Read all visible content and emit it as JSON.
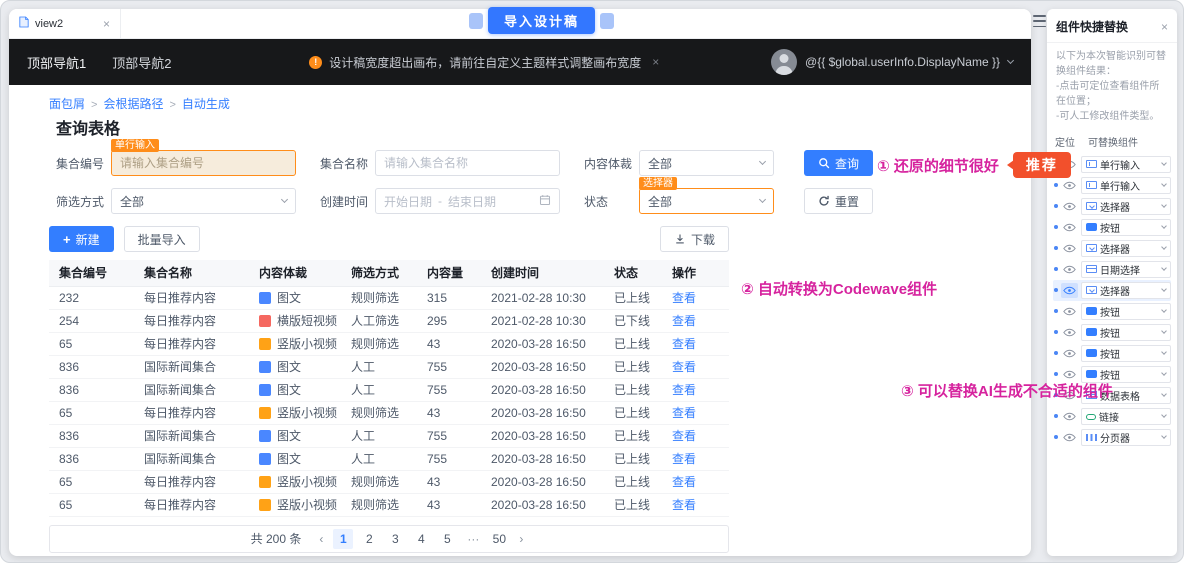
{
  "tab_bar": {
    "tab_title": "view2",
    "close": "×"
  },
  "import_badge": {
    "label": "导入设计稿"
  },
  "navbar": {
    "nav_item1": "顶部导航1",
    "nav_item2": "顶部导航2",
    "warning_text": "设计稿宽度超出画布，请前往自定义主题样式调整画布宽度",
    "warning_close": "×",
    "user_display": "@{{ $global.userInfo.DisplayName }}"
  },
  "breadcrumb": {
    "items": [
      "面包屑",
      "会根据路径",
      "自动生成"
    ],
    "separator": ">"
  },
  "query_form": {
    "title": "查询表格",
    "fields": {
      "collection_id": {
        "label": "集合编号",
        "placeholder": "请输入集合编号",
        "tag": "单行输入"
      },
      "collection_name": {
        "label": "集合名称",
        "placeholder": "请输入集合名称"
      },
      "genre": {
        "label": "内容体裁",
        "value": "全部"
      },
      "filter_method": {
        "label": "筛选方式",
        "value": "全部"
      },
      "create_time": {
        "label": "创建时间",
        "start_placeholder": "开始日期",
        "separator": "-",
        "end_placeholder": "结束日期"
      },
      "status": {
        "label": "状态",
        "value": "全部",
        "tag": "选择器"
      }
    },
    "search_button": "查询",
    "reset_button": "重置"
  },
  "toolbar": {
    "new_button": "新建",
    "batch_import_button": "批量导入",
    "download_button": "下载"
  },
  "table": {
    "columns": [
      "集合编号",
      "集合名称",
      "内容体裁",
      "筛选方式",
      "内容量",
      "创建时间",
      "状态",
      "操作"
    ],
    "action_label": "查看",
    "rows": [
      {
        "id": "232",
        "name": "每日推荐内容",
        "genre": "图文",
        "genre_color": "#4a87ff",
        "filter": "规则筛选",
        "amount": "315",
        "created": "2021-02-28 10:30",
        "status": "已上线"
      },
      {
        "id": "254",
        "name": "每日推荐内容",
        "genre": "横版短视频",
        "genre_color": "#f56860",
        "filter": "人工筛选",
        "amount": "295",
        "created": "2021-02-28 10:30",
        "status": "已下线"
      },
      {
        "id": "65",
        "name": "每日推荐内容",
        "genre": "竖版小视频",
        "genre_color": "#ffa216",
        "filter": "规则筛选",
        "amount": "43",
        "created": "2020-03-28 16:50",
        "status": "已上线"
      },
      {
        "id": "836",
        "name": "国际新闻集合",
        "genre": "图文",
        "genre_color": "#4a87ff",
        "filter": "人工",
        "amount": "755",
        "created": "2020-03-28 16:50",
        "status": "已上线"
      },
      {
        "id": "836",
        "name": "国际新闻集合",
        "genre": "图文",
        "genre_color": "#4a87ff",
        "filter": "人工",
        "amount": "755",
        "created": "2020-03-28 16:50",
        "status": "已上线"
      },
      {
        "id": "65",
        "name": "每日推荐内容",
        "genre": "竖版小视频",
        "genre_color": "#ffa216",
        "filter": "规则筛选",
        "amount": "43",
        "created": "2020-03-28 16:50",
        "status": "已上线"
      },
      {
        "id": "836",
        "name": "国际新闻集合",
        "genre": "图文",
        "genre_color": "#4a87ff",
        "filter": "人工",
        "amount": "755",
        "created": "2020-03-28 16:50",
        "status": "已上线"
      },
      {
        "id": "836",
        "name": "国际新闻集合",
        "genre": "图文",
        "genre_color": "#4a87ff",
        "filter": "人工",
        "amount": "755",
        "created": "2020-03-28 16:50",
        "status": "已上线"
      },
      {
        "id": "65",
        "name": "每日推荐内容",
        "genre": "竖版小视频",
        "genre_color": "#ffa216",
        "filter": "规则筛选",
        "amount": "43",
        "created": "2020-03-28 16:50",
        "status": "已上线"
      },
      {
        "id": "65",
        "name": "每日推荐内容",
        "genre": "竖版小视频",
        "genre_color": "#ffa216",
        "filter": "规则筛选",
        "amount": "43",
        "created": "2020-03-28 16:50",
        "status": "已上线"
      }
    ]
  },
  "pagination": {
    "total": "共 200 条",
    "prev": "‹",
    "next": "›",
    "pages": [
      "1",
      "2",
      "3",
      "4",
      "5",
      "···",
      "50"
    ],
    "active_page": "1"
  },
  "annotations": {
    "note1": "① 还原的细节很好",
    "badge1": "推荐",
    "note2": "② 自动转换为Codewave组件",
    "note3": "③ 可以替换AI生成不合适的组件"
  },
  "side_panel": {
    "title": "组件快捷替换",
    "close": "×",
    "description": [
      "以下为本次智能识别可替换组件结果：",
      "-点击可定位查看组件所在位置；",
      "-可人工修改组件类型。"
    ],
    "header_locate": "定位",
    "header_component": "可替换组件",
    "items": [
      {
        "label": "单行输入",
        "icon": "input-icon",
        "active": false
      },
      {
        "label": "单行输入",
        "icon": "input-icon",
        "active": false
      },
      {
        "label": "选择器",
        "icon": "select-icon",
        "active": false
      },
      {
        "label": "按钮",
        "icon": "button-icon",
        "active": false
      },
      {
        "label": "选择器",
        "icon": "select-icon",
        "active": false
      },
      {
        "label": "日期选择",
        "icon": "date-icon",
        "active": false
      },
      {
        "label": "选择器",
        "icon": "select-icon",
        "active": true
      },
      {
        "label": "按钮",
        "icon": "button-icon",
        "active": false
      },
      {
        "label": "按钮",
        "icon": "button-icon",
        "active": false
      },
      {
        "label": "按钮",
        "icon": "button-icon",
        "active": false
      },
      {
        "label": "按钮",
        "icon": "button-icon",
        "active": false
      },
      {
        "label": "数据表格",
        "icon": "table-icon",
        "active": false
      },
      {
        "label": "链接",
        "icon": "link-icon",
        "active": false
      },
      {
        "label": "分页器",
        "icon": "pagination-icon",
        "active": false
      }
    ]
  },
  "colors": {
    "accent_blue": "#337eff",
    "highlight_orange": "#ff8d1a",
    "annotation_pink": "#d6239e",
    "badge_red": "#f2502c"
  }
}
